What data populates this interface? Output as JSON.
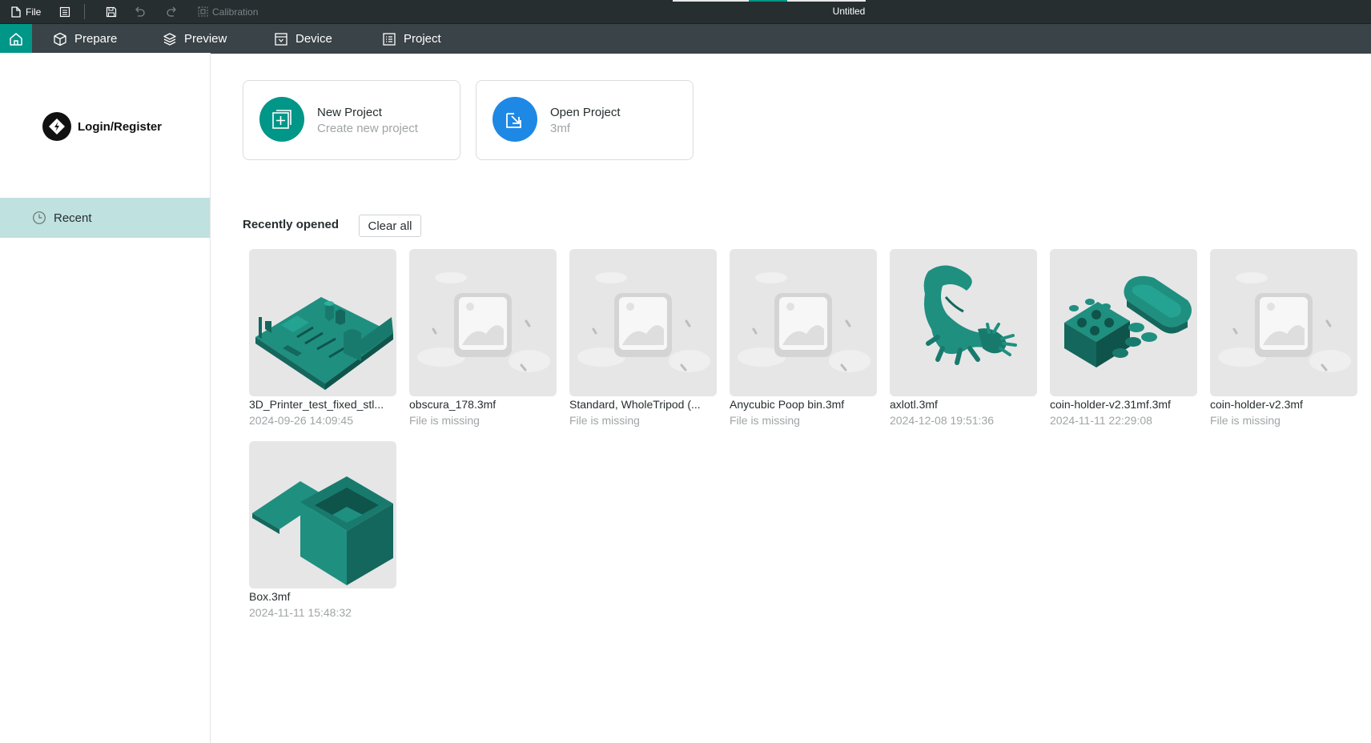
{
  "titlebar": {
    "file_label": "File",
    "calibration_label": "Calibration",
    "window_title": "Untitled"
  },
  "tabs": [
    {
      "label": "Prepare",
      "icon": "cube-icon"
    },
    {
      "label": "Preview",
      "icon": "layers-icon"
    },
    {
      "label": "Device",
      "icon": "device-icon"
    },
    {
      "label": "Project",
      "icon": "list-icon"
    }
  ],
  "sidebar": {
    "login_label": "Login/Register",
    "recent_label": "Recent"
  },
  "actions": {
    "new_project": {
      "title": "New Project",
      "subtitle": "Create new project"
    },
    "open_project": {
      "title": "Open Project",
      "subtitle": "3mf"
    }
  },
  "recent": {
    "heading": "Recently opened",
    "clear_label": "Clear all",
    "items": [
      {
        "name": "3D_Printer_test_fixed_stl...",
        "sub": "2024-09-26 14:09:45",
        "thumb": "test-model"
      },
      {
        "name": "obscura_178.3mf",
        "sub": "File is missing",
        "thumb": "placeholder"
      },
      {
        "name": "Standard, WholeTripod (...",
        "sub": "File is missing",
        "thumb": "placeholder"
      },
      {
        "name": "Anycubic Poop bin.3mf",
        "sub": "File is missing",
        "thumb": "placeholder"
      },
      {
        "name": "axlotl.3mf",
        "sub": "2024-12-08 19:51:36",
        "thumb": "axolotl"
      },
      {
        "name": "coin-holder-v2.31mf.3mf",
        "sub": "2024-11-11 22:29:08",
        "thumb": "coin-holder"
      },
      {
        "name": "coin-holder-v2.3mf",
        "sub": "File is missing",
        "thumb": "placeholder"
      },
      {
        "name": "Box.3mf",
        "sub": "2024-11-11 15:48:32",
        "thumb": "box"
      }
    ]
  },
  "colors": {
    "accent": "#009688",
    "open_blue": "#1e88e5",
    "titlebar_bg": "#262e30",
    "tabbar_bg": "#3a4347",
    "model_green": "#1f8f80"
  }
}
